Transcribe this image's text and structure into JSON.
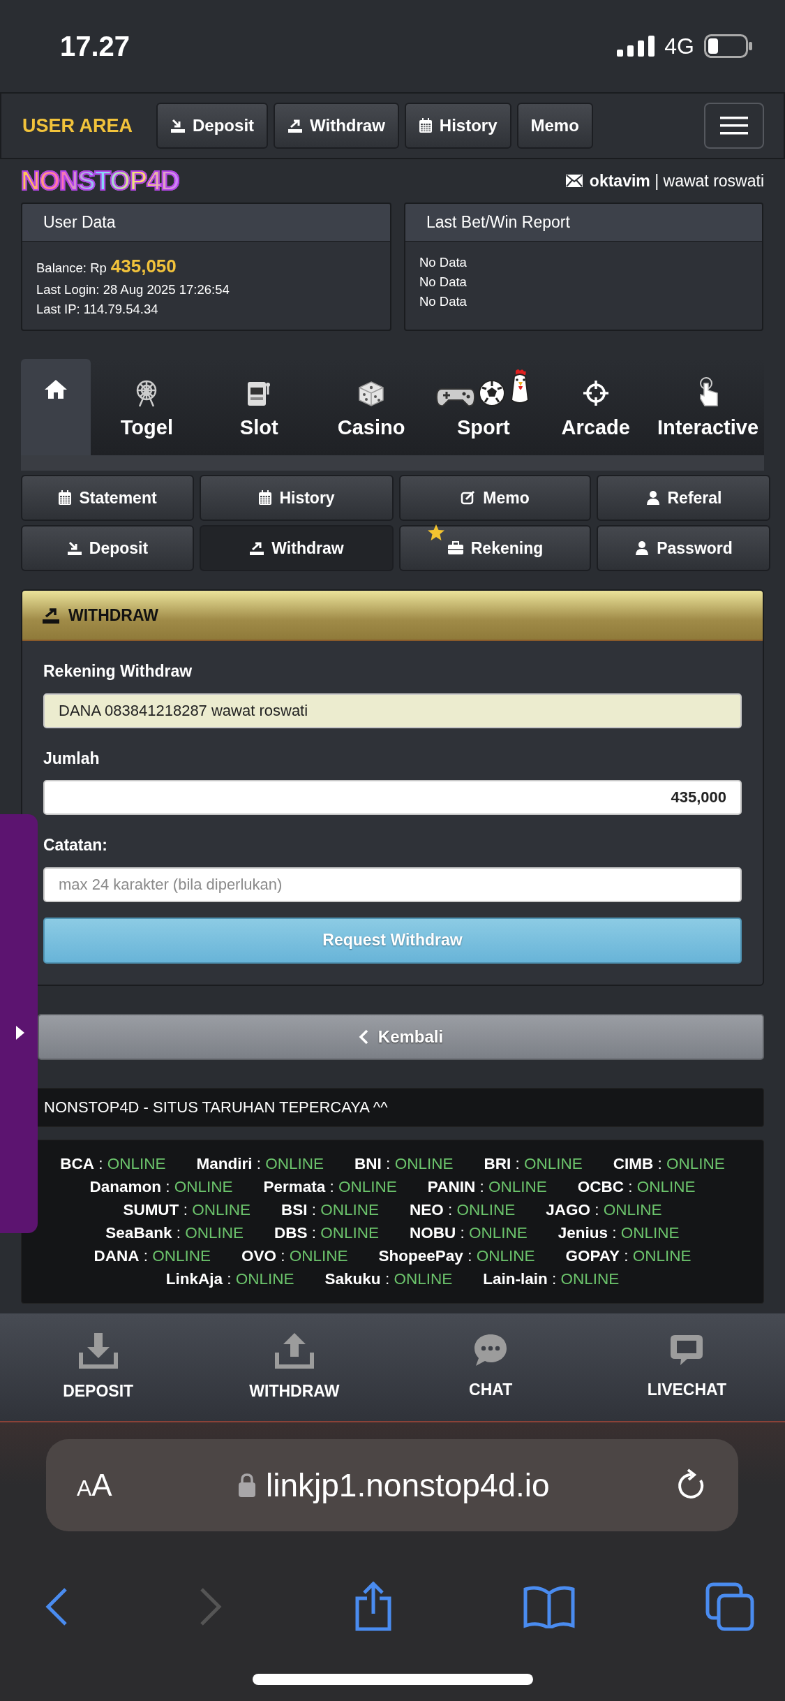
{
  "status_bar": {
    "time": "17.27",
    "network": "4G"
  },
  "navbar": {
    "brand": "USER AREA",
    "buttons": [
      "Deposit",
      "Withdraw",
      "History",
      "Memo"
    ]
  },
  "logo": "NONSTOP4D",
  "account": "**oktavim** | wawat roswati",
  "user_data": {
    "title": "User Data",
    "balance_label": "Balance: Rp",
    "balance": "435,050",
    "last_login": "Last Login: 28 Aug 2025 17:26:54",
    "last_ip": "Last IP: 114.79.54.34"
  },
  "report": {
    "title": "Last Bet/Win Report",
    "rows": [
      "No Data",
      "No Data",
      "No Data"
    ]
  },
  "game_tabs": [
    {
      "selected": true
    },
    {
      "label": "Togel",
      "selected": false
    },
    {
      "label": "Slot",
      "selected": false
    },
    {
      "label": "Casino",
      "selected": false
    },
    {
      "label": "Sport",
      "selected": false
    },
    {
      "label": "Arcade",
      "selected": false
    },
    {
      "label": "Interactive",
      "selected": false
    }
  ],
  "menu_buttons": [
    {
      "label": "Statement",
      "selected": false
    },
    {
      "label": "History",
      "selected": false
    },
    {
      "label": "Memo",
      "selected": false
    },
    {
      "label": "Referal",
      "selected": false
    },
    {
      "label": "Deposit",
      "selected": false
    },
    {
      "label": "Withdraw",
      "selected": true
    },
    {
      "label": "Rekening",
      "selected": false
    },
    {
      "label": "Password",
      "selected": false
    }
  ],
  "withdraw": {
    "title": "WITHDRAW",
    "fields": [
      {
        "label": "Rekening Withdraw",
        "kind": "readonly",
        "value": "DANA 083841218287 wawat roswati"
      },
      {
        "label": "Jumlah",
        "kind": "amount",
        "value": "435,000"
      },
      {
        "label": "Catatan:",
        "kind": "text",
        "placeholder": "max 24 karakter (bila diperlukan)"
      }
    ],
    "submit": "Request Withdraw"
  },
  "back_button": "Kembali",
  "marquee": "NONSTOP4D - SITUS TARUHAN TEPERCAYA ^^",
  "banks": [
    [
      {
        "bank": "BCA",
        "sep": ":",
        "status": "ONLINE"
      },
      {
        "bank": "Mandiri",
        "sep": ":",
        "status": "ONLINE"
      },
      {
        "bank": "BNI",
        "sep": ":",
        "status": "ONLINE"
      },
      {
        "bank": "BRI",
        "sep": ":",
        "status": "ONLINE"
      },
      {
        "bank": "CIMB",
        "sep": ":",
        "status": "ONLINE"
      }
    ],
    [
      {
        "bank": "Danamon",
        "sep": ":",
        "status": "ONLINE"
      },
      {
        "bank": "Permata",
        "sep": ":",
        "status": "ONLINE"
      },
      {
        "bank": "PANIN",
        "sep": ":",
        "status": "ONLINE"
      },
      {
        "bank": "OCBC",
        "sep": ":",
        "status": "ONLINE"
      }
    ],
    [
      {
        "bank": "SUMUT",
        "sep": ":",
        "status": "ONLINE"
      },
      {
        "bank": "BSI",
        "sep": ":",
        "status": "ONLINE"
      },
      {
        "bank": "NEO",
        "sep": ":",
        "status": "ONLINE"
      },
      {
        "bank": "JAGO",
        "sep": ":",
        "status": "ONLINE"
      }
    ],
    [
      {
        "bank": "SeaBank",
        "sep": ":",
        "status": "ONLINE"
      },
      {
        "bank": "DBS",
        "sep": ":",
        "status": "ONLINE"
      },
      {
        "bank": "NOBU",
        "sep": ":",
        "status": "ONLINE"
      },
      {
        "bank": "Jenius",
        "sep": ":",
        "status": "ONLINE"
      }
    ],
    [
      {
        "bank": "DANA",
        "sep": ":",
        "status": "ONLINE"
      },
      {
        "bank": "OVO",
        "sep": ":",
        "status": "ONLINE"
      },
      {
        "bank": "ShopeePay",
        "sep": ":",
        "status": "ONLINE"
      },
      {
        "bank": "GOPAY",
        "sep": ":",
        "status": "ONLINE"
      }
    ],
    [
      {
        "bank": "LinkAja",
        "sep": ":",
        "status": "ONLINE"
      },
      {
        "bank": "Sakuku",
        "sep": ":",
        "status": "ONLINE"
      },
      {
        "bank": "Lain-lain",
        "sep": ":",
        "status": "ONLINE"
      }
    ]
  ],
  "bottom_nav": [
    "DEPOSIT",
    "WITHDRAW",
    "CHAT",
    "LIVECHAT"
  ],
  "browser": {
    "text_size": "AA",
    "url": "linkjp1.nonstop4d.io"
  }
}
